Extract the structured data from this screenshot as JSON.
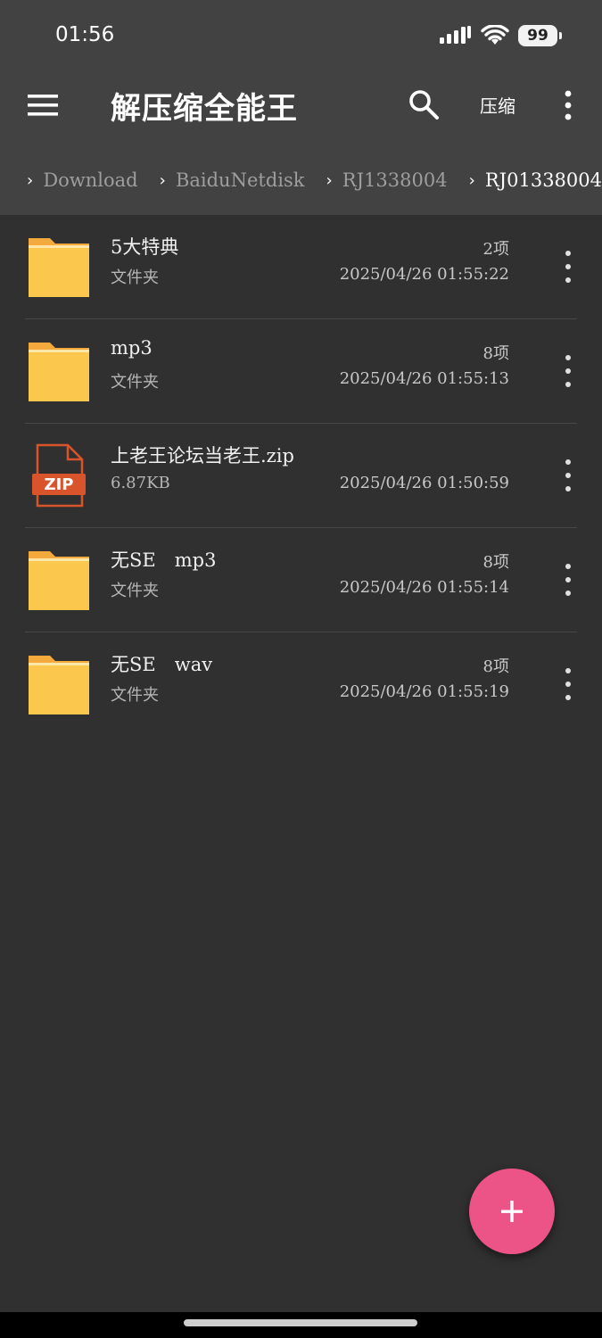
{
  "status_bar": {
    "time": "01:56",
    "battery": "99"
  },
  "toolbar": {
    "title": "解压缩全能王",
    "compress_label": "压缩"
  },
  "breadcrumb": {
    "items": [
      {
        "label": "Download"
      },
      {
        "label": "BaiduNetdisk"
      },
      {
        "label": "RJ1338004"
      },
      {
        "label": "RJ01338004"
      }
    ]
  },
  "files": [
    {
      "name": "5大特典",
      "type": "folder",
      "subtitle": "文件夹",
      "count": "2项",
      "date": "2025/04/26  01:55:22"
    },
    {
      "name": "mp3",
      "type": "folder",
      "subtitle": "文件夹",
      "count": "8项",
      "date": "2025/04/26  01:55:13"
    },
    {
      "name": "上老王论坛当老王.zip",
      "type": "zip",
      "subtitle": "6.87KB",
      "count": "",
      "date": "2025/04/26  01:50:59"
    },
    {
      "name": "无SE　mp3",
      "type": "folder",
      "subtitle": "文件夹",
      "count": "8项",
      "date": "2025/04/26  01:55:14"
    },
    {
      "name": "无SE　wav",
      "type": "folder",
      "subtitle": "文件夹",
      "count": "8项",
      "date": "2025/04/26  01:55:19"
    }
  ],
  "zip_icon_text": "ZIP",
  "colors": {
    "accent": "#ec5387",
    "folder": "#f9c74f",
    "zip": "#d9542b",
    "toolbar_bg": "#424242",
    "list_bg": "#303030"
  },
  "icons": {
    "menu": "hamburger-icon",
    "search": "search-icon",
    "more": "more-vert-icon",
    "chevron": "chevron-right-icon",
    "folder": "folder-icon",
    "zip": "zip-file-icon",
    "add": "plus-icon"
  }
}
